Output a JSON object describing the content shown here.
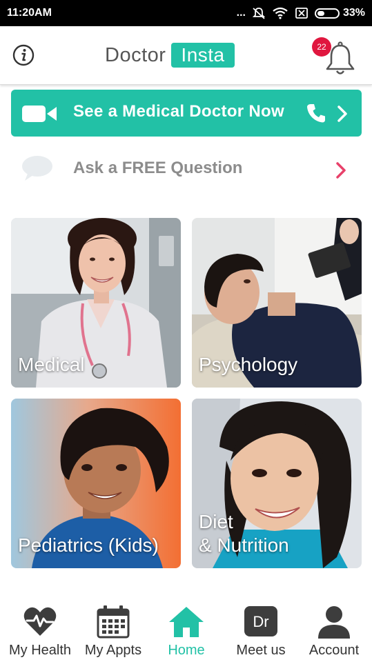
{
  "status_bar": {
    "time": "11:20AM",
    "dots": "...",
    "battery": "33%"
  },
  "header": {
    "logo_doctor": "Doctor",
    "logo_insta": "Insta",
    "notification_count": "22"
  },
  "cta": {
    "label": "See a Medical Doctor Now"
  },
  "ask": {
    "label": "Ask a FREE Question"
  },
  "categories": [
    {
      "label": "Medical"
    },
    {
      "label": "Psychology"
    },
    {
      "label": "Pediatrics (Kids)"
    },
    {
      "label_line1": "Diet",
      "label_line2": "& Nutrition"
    }
  ],
  "tabs": [
    {
      "label": "My Health",
      "icon": "heart-pulse-icon"
    },
    {
      "label": "My Appts",
      "icon": "calendar-icon"
    },
    {
      "label": "Home",
      "icon": "home-icon"
    },
    {
      "label": "Meet us",
      "icon": "dr-icon",
      "icon_text": "Dr"
    },
    {
      "label": "Account",
      "icon": "person-icon"
    }
  ],
  "colors": {
    "accent": "#22c1a6",
    "badge": "#e0173f",
    "chevron_pink": "#e8416a"
  }
}
